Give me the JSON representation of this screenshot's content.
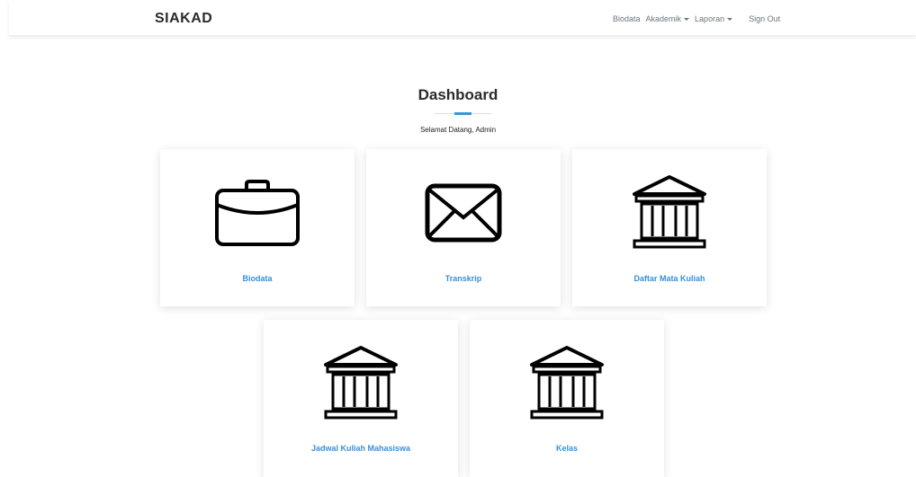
{
  "navbar": {
    "brand": "SIAKAD",
    "items": [
      {
        "label": "Biodata",
        "dropdown": false
      },
      {
        "label": "Akademik",
        "dropdown": true
      },
      {
        "label": "Laporan",
        "dropdown": true
      }
    ],
    "signout": "Sign Out"
  },
  "main": {
    "title": "Dashboard",
    "subtitle": "Selamat Datang, Admin",
    "accent_color": "#3498db",
    "cards": [
      {
        "label": "Biodata",
        "icon": "briefcase-icon"
      },
      {
        "label": "Transkrip",
        "icon": "envelope-icon"
      },
      {
        "label": "Daftar Mata Kuliah",
        "icon": "bank-building-icon"
      },
      {
        "label": "Jadwal Kuliah Mahasiswa",
        "icon": "bank-building-icon"
      },
      {
        "label": "Kelas",
        "icon": "bank-building-icon"
      }
    ]
  }
}
